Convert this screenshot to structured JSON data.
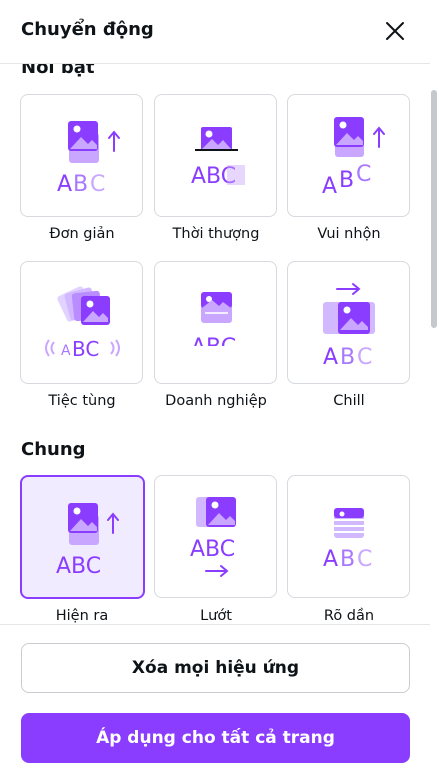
{
  "panel": {
    "title": "Chuyển động",
    "close_icon": "close-icon"
  },
  "sections": {
    "featured": {
      "title": "Nổi bật",
      "items": [
        {
          "label": "Đơn giản",
          "icon": "simple-animation-icon"
        },
        {
          "label": "Thời thượng",
          "icon": "trendy-animation-icon"
        },
        {
          "label": "Vui nhộn",
          "icon": "playful-animation-icon"
        },
        {
          "label": "Tiệc tùng",
          "icon": "party-animation-icon"
        },
        {
          "label": "Doanh nghiệp",
          "icon": "business-animation-icon"
        },
        {
          "label": "Chill",
          "icon": "chill-animation-icon"
        }
      ]
    },
    "general": {
      "title": "Chung",
      "items": [
        {
          "label": "Hiện ra",
          "icon": "rise-animation-icon",
          "selected": true
        },
        {
          "label": "Lướt",
          "icon": "pan-animation-icon"
        },
        {
          "label": "Rõ dần",
          "icon": "fade-animation-icon"
        }
      ]
    }
  },
  "preview_text": "ABC",
  "buttons": {
    "clear": "Xóa mọi hiệu ứng",
    "apply": "Áp dụng cho tất cả trang"
  },
  "colors": {
    "accent": "#8b3dff",
    "accent_light": "#c9a6ff",
    "selected_bg": "#f1ebff",
    "text": "#0e1318"
  }
}
